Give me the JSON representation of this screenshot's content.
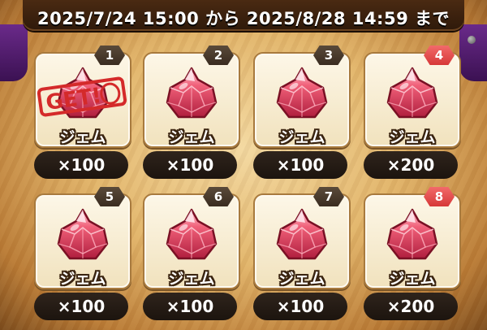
{
  "banner": {
    "text": "2025/7/24 15:00 から 2025/8/28 14:59 まで"
  },
  "rewards": [
    {
      "number": "1",
      "name": "ジェム",
      "quantity": "×100",
      "badge_color": "gray",
      "claimed": true,
      "stamp_text": "GET!"
    },
    {
      "number": "2",
      "name": "ジェム",
      "quantity": "×100",
      "badge_color": "gray",
      "claimed": false
    },
    {
      "number": "3",
      "name": "ジェム",
      "quantity": "×100",
      "badge_color": "gray",
      "claimed": false
    },
    {
      "number": "4",
      "name": "ジェム",
      "quantity": "×200",
      "badge_color": "red",
      "claimed": false
    },
    {
      "number": "5",
      "name": "ジェム",
      "quantity": "×100",
      "badge_color": "gray",
      "claimed": false
    },
    {
      "number": "6",
      "name": "ジェム",
      "quantity": "×100",
      "badge_color": "gray",
      "claimed": false
    },
    {
      "number": "7",
      "name": "ジェム",
      "quantity": "×100",
      "badge_color": "gray",
      "claimed": false
    },
    {
      "number": "8",
      "name": "ジェム",
      "quantity": "×200",
      "badge_color": "red",
      "claimed": false
    }
  ],
  "colors": {
    "badge_gray": "#4a3a2a",
    "badge_red": "#e04848",
    "gem": "#e0405a",
    "stamp": "#d42a2a"
  },
  "icons": {
    "reward_item": "gem-icon"
  }
}
